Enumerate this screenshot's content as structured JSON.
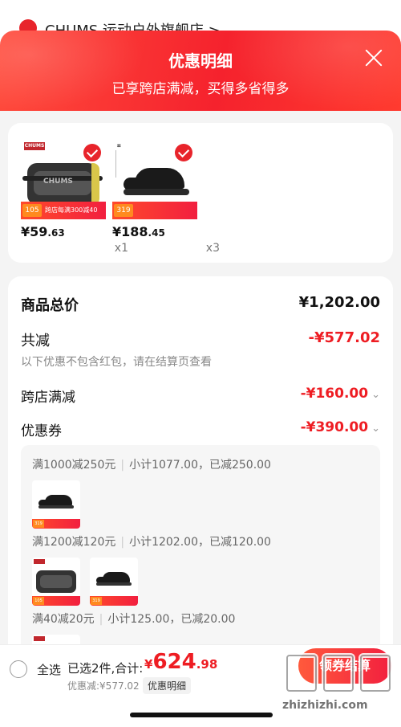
{
  "store": {
    "name": "CHUMS 运动户外旗舰店 >"
  },
  "sheet": {
    "title": "优惠明细",
    "subtitle": "已享跨店满减，买得多省得多"
  },
  "products": [
    {
      "brand": "CHUMS",
      "badge_price": "105",
      "badge_text": "跨店每满300减40",
      "price_int": "¥59",
      "price_dec": ".63",
      "qty": "x1"
    },
    {
      "brand": "UA",
      "badge_price": "319",
      "badge_text": "",
      "price_int": "¥188",
      "price_dec": ".45",
      "qty": "x3"
    }
  ],
  "summary": {
    "total_label": "商品总价",
    "total_value": "¥1,202.00",
    "reduce_label": "共减",
    "reduce_value": "-¥577.02",
    "note": "以下优惠不包含红包，请在结算页查看",
    "cross_store_label": "跨店满减",
    "cross_store_value": "-¥160.00",
    "coupon_label": "优惠券",
    "coupon_value": "-¥390.00",
    "chevron": "⌄"
  },
  "coupons": [
    {
      "rule": "满1000减250元",
      "detail": "小计1077.00，已减250.00"
    },
    {
      "rule": "满1200减120元",
      "detail": "小计1202.00，已减120.00"
    },
    {
      "rule": "满40减20元",
      "detail": "小计125.00，已减20.00"
    }
  ],
  "thumb_badges": {
    "shoe": "319",
    "bag": "105"
  },
  "bottom": {
    "select_all": "全选",
    "selected": "已选2件,合计:",
    "currency": "¥",
    "total_int": "624",
    "total_dec": ".98",
    "discount": "优惠减:¥577.02",
    "detail_button": "优惠明细",
    "checkout_button": "领券结算"
  },
  "watermark": {
    "text": "zhizhizhi.com"
  },
  "colors": {
    "accent": "#ee1d23",
    "header_start": "#ff4b3c",
    "header_end": "#f5222d"
  }
}
